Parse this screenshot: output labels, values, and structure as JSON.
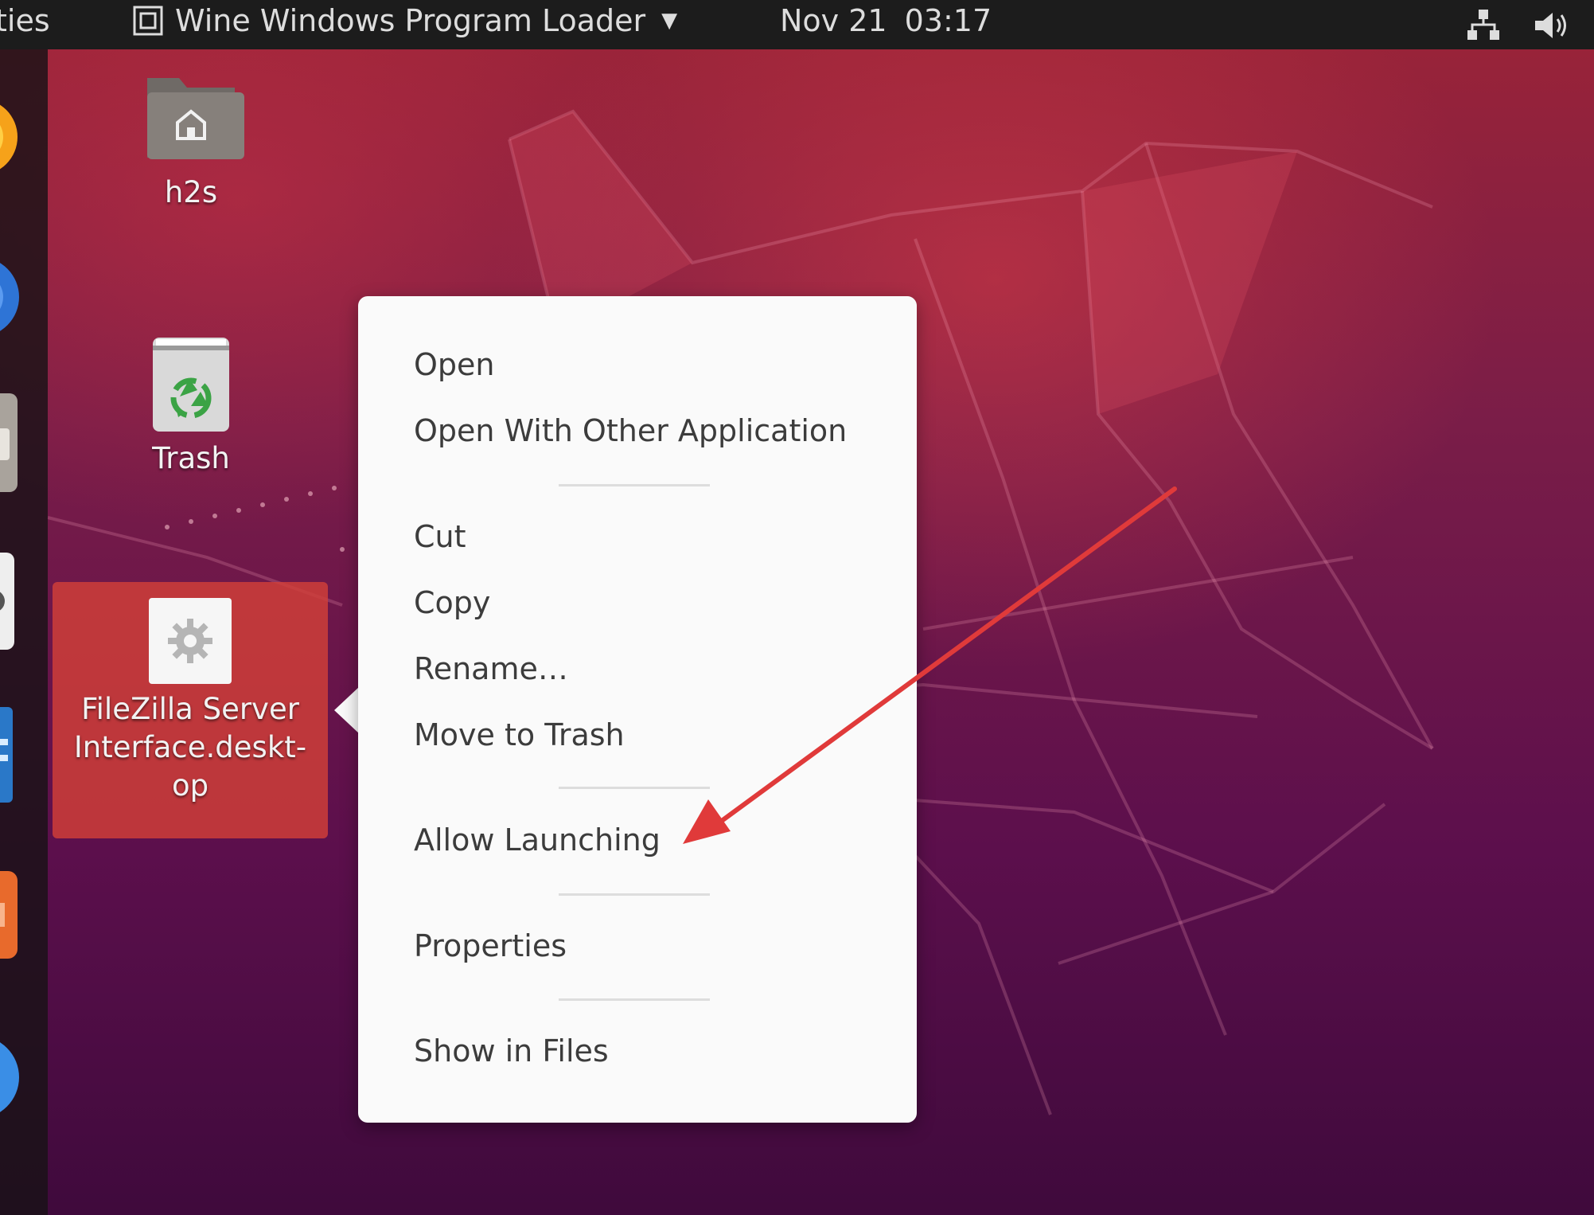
{
  "topbar": {
    "activities_label": "ties",
    "app_menu_label": "Wine Windows Program Loader",
    "date": "Nov 21",
    "time": "03:17",
    "icons": [
      "wine-app-icon",
      "chevron-down-icon",
      "network-icon",
      "volume-icon"
    ]
  },
  "dock": {
    "items": [
      "firefox-icon",
      "thunderbird-icon",
      "files-icon",
      "rhythmbox-icon",
      "libreoffice-writer-icon",
      "software-center-icon",
      "help-icon"
    ]
  },
  "desktop": {
    "icons": [
      {
        "label": "h2s",
        "icon": "home-folder-icon"
      },
      {
        "label": "Trash",
        "icon": "trash-icon"
      },
      {
        "label_lines": [
          "FileZilla Server",
          "Interface.deskt-",
          "op"
        ],
        "icon": "gear-icon",
        "selected": true
      }
    ]
  },
  "context_menu": {
    "items": [
      "Open",
      "Open With Other Application",
      "Cut",
      "Copy",
      "Rename…",
      "Move to Trash",
      "Allow Launching",
      "Properties",
      "Show in Files"
    ]
  },
  "annotation": {
    "type": "arrow",
    "color": "#e03a3a",
    "points_to": "Allow Launching"
  },
  "colors": {
    "topbar_bg": "#1c1c1c",
    "menu_bg": "#fafafa",
    "selection": "#d24038",
    "wallpaper_top": "#9c2437",
    "wallpaper_bottom": "#3f0a3c"
  }
}
